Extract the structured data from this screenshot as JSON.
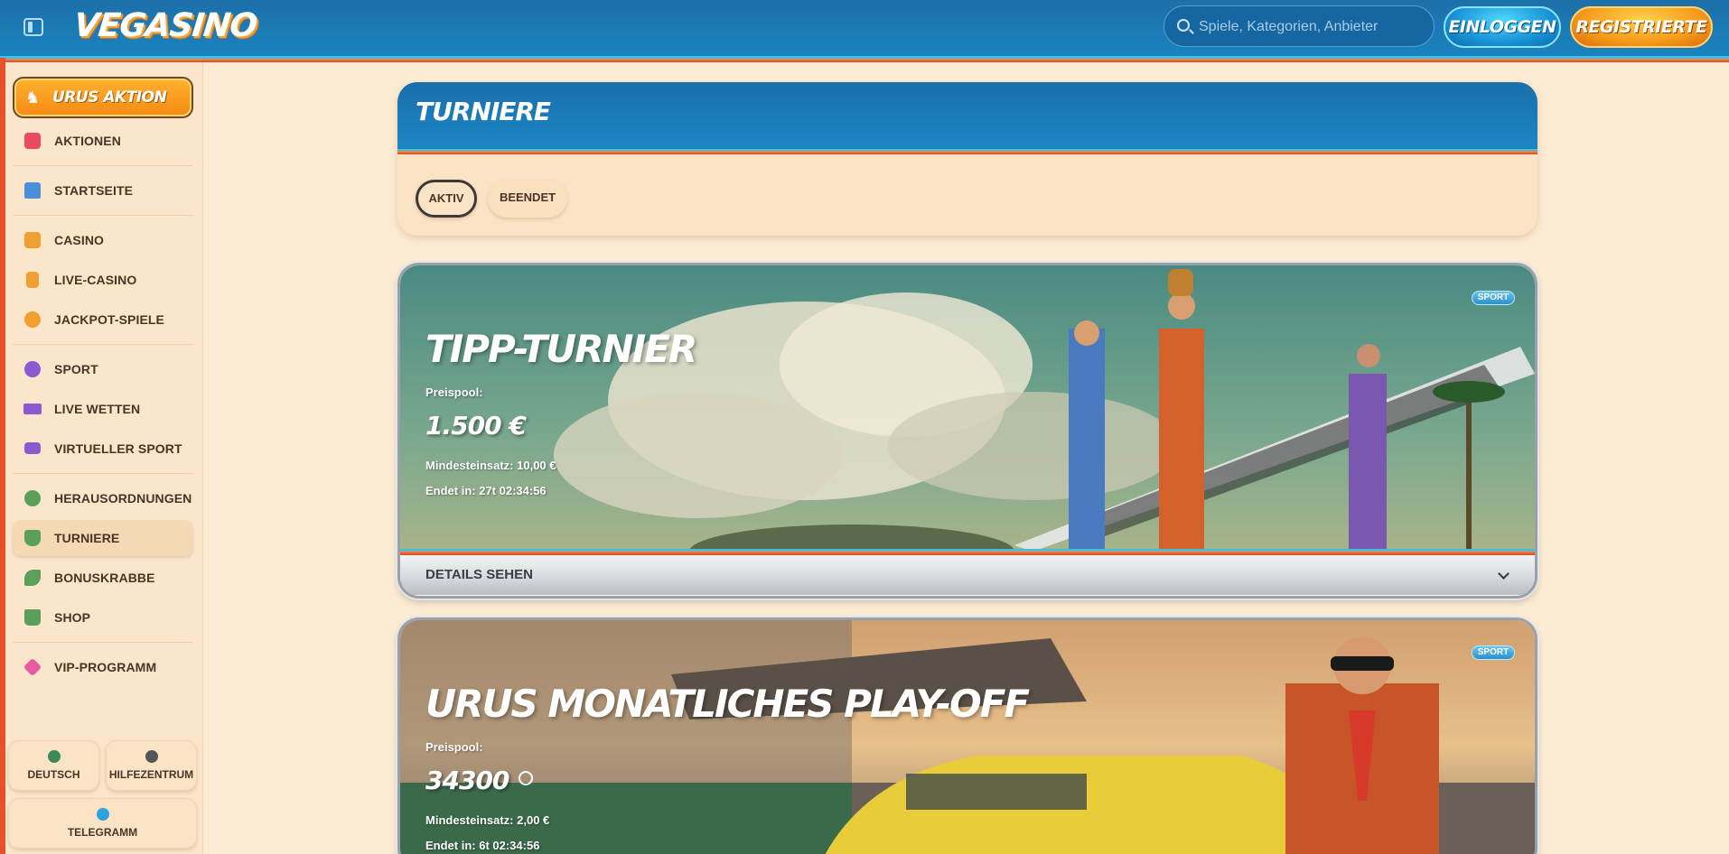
{
  "header": {
    "logo": "VEGASINO",
    "search_placeholder": "Spiele, Kategorien, Anbieter",
    "login_label": "EINLOGGEN",
    "register_label": "REGISTRIERTE"
  },
  "sidebar": {
    "promo_label": "URUS AKTION",
    "items": [
      {
        "label": "AKTIONEN",
        "icon": "gift-icon",
        "color": "#e84a5f"
      },
      {
        "label": "STARTSEITE",
        "icon": "home-icon",
        "color": "#4a90d9"
      },
      {
        "label": "CASINO",
        "icon": "slot-machine-icon",
        "color": "#f0a030"
      },
      {
        "label": "LIVE-CASINO",
        "icon": "card-icon",
        "color": "#f0a030"
      },
      {
        "label": "JACKPOT-SPIELE",
        "icon": "clover-icon",
        "color": "#f0a030"
      },
      {
        "label": "SPORT",
        "icon": "ball-icon",
        "color": "#8a5ad0"
      },
      {
        "label": "LIVE WETTEN",
        "icon": "live-icon",
        "color": "#8a5ad0"
      },
      {
        "label": "VIRTUELLER SPORT",
        "icon": "virtual-icon",
        "color": "#8a5ad0"
      },
      {
        "label": "HERAUSORDNUNGEN",
        "icon": "badge-icon",
        "color": "#5aa05a"
      },
      {
        "label": "TURNIERE",
        "icon": "trophy-icon",
        "color": "#5aa05a"
      },
      {
        "label": "BONUSKRABBE",
        "icon": "leaf-icon",
        "color": "#5aa05a"
      },
      {
        "label": "SHOP",
        "icon": "bag-icon",
        "color": "#5aa05a"
      },
      {
        "label": "VIP-PROGRAMM",
        "icon": "diamond-icon",
        "color": "#e85aa0"
      }
    ],
    "bottom": {
      "language": "DEUTSCH",
      "help": "HILFEZENTRUM",
      "telegram": "TELEGRAMM"
    }
  },
  "main": {
    "title": "TURNIERE",
    "tabs": [
      {
        "label": "AKTIV",
        "active": true
      },
      {
        "label": "BEENDET",
        "active": false
      }
    ],
    "cards": [
      {
        "title": "TIPP-TURNIER",
        "pool_label": "Preispool:",
        "pool_value": "1.500 €",
        "min_bet": "Mindesteinsatz: 10,00 €",
        "ends": "Endet in: 27t 02:34:56",
        "badge": "SPORT",
        "details_label": "DETAILS SEHEN"
      },
      {
        "title": "URUS MONATLICHES PLAY-OFF",
        "pool_label": "Preispool:",
        "pool_value": "34300",
        "min_bet": "Mindesteinsatz: 2,00 €",
        "ends": "Endet in: 6t 02:34:56",
        "badge": "SPORT"
      }
    ]
  }
}
